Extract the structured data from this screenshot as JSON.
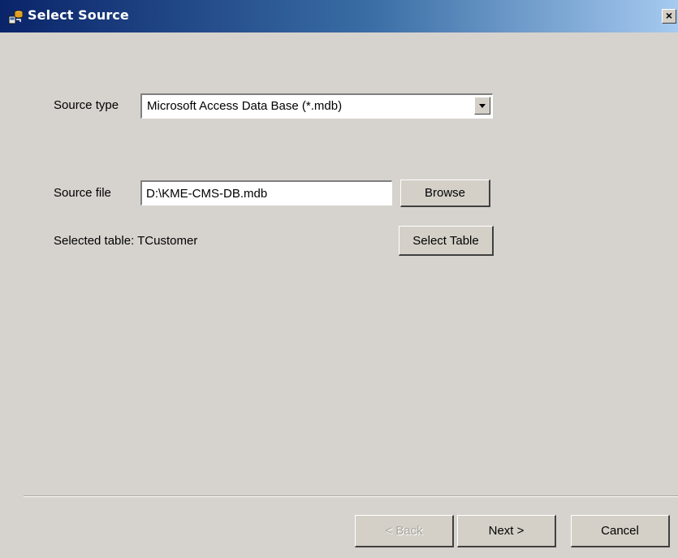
{
  "window": {
    "title": "Select Source",
    "close_glyph": "×",
    "app_icon": "database-icon"
  },
  "source_type": {
    "label": "Source type",
    "selected": "Microsoft Access Data Base (*.mdb)"
  },
  "source_file": {
    "label": "Source file",
    "value": "D:\\KME-CMS-DB.mdb",
    "browse_label": "Browse"
  },
  "table": {
    "selected_text": "Selected table: TCustomer",
    "select_label": "Select Table"
  },
  "footer": {
    "back_label": "< Back",
    "back_enabled": false,
    "next_label": "Next >",
    "cancel_label": "Cancel"
  },
  "colors": {
    "titlebar_start": "#0a246a",
    "titlebar_end": "#a6caf0",
    "dialog_bg": "#d6d3ce"
  }
}
